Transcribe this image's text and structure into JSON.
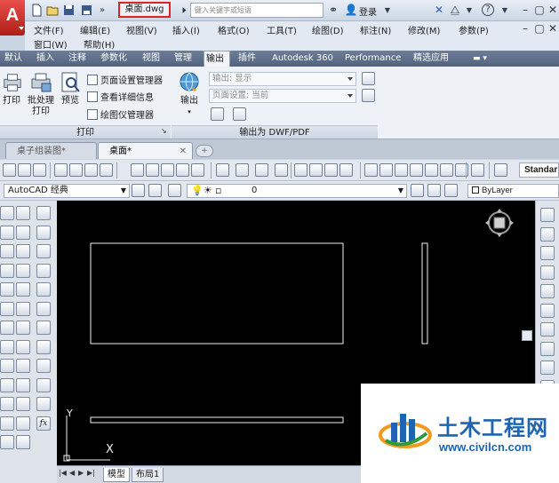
{
  "titlebar": {
    "filename": "桌面.dwg",
    "search_placeholder": "键入关键字或短语",
    "login_label": "登录",
    "help_icon": "?"
  },
  "menubar": {
    "row1": [
      "文件(F)",
      "编辑(E)",
      "视图(V)",
      "插入(I)",
      "格式(O)",
      "工具(T)",
      "绘图(D)",
      "标注(N)",
      "修改(M)",
      "参数(P)"
    ],
    "row2": [
      "窗口(W)",
      "帮助(H)"
    ]
  },
  "ribbon_tabs": [
    "默认",
    "插入",
    "注释",
    "参数化",
    "视图",
    "管理",
    "输出",
    "插件",
    "Autodesk 360",
    "Performance",
    "精选应用"
  ],
  "ribbon": {
    "print_panel": {
      "plot_label": "打印",
      "batch_plot_label": "批处理打印",
      "preview_label": "预览",
      "page_setup_label": "页面设置管理器",
      "details_label": "查看详细信息",
      "plotter_label": "绘图仪管理器",
      "footer": "打印"
    },
    "export_panel": {
      "export_label": "输出",
      "export_combo": "输出: 显示",
      "page_setup_combo": "页面设置: 当前",
      "footer": "输出为 DWF/PDF"
    }
  },
  "doc_tabs": [
    {
      "label": "桌子组装图*",
      "active": false
    },
    {
      "label": "桌面*",
      "active": true
    }
  ],
  "toolbar": {
    "standard_dropdown": "Standar",
    "workspace_dropdown": "AutoCAD 经典",
    "layer_value": "0",
    "color_value": "ByLayer"
  },
  "canvas": {
    "ucs_y_label": "Y",
    "ucs_x_label": "X"
  },
  "model_tabs": [
    "模型",
    "布局1"
  ],
  "watermark": {
    "title": "土木工程网",
    "url": "www.civilcn.com"
  },
  "colors": {
    "canvas_bg": "#000000",
    "ribbon_tab_bg": "#5f7089",
    "highlight_box": "#dd2222",
    "watermark_blue": "#1f64b0"
  }
}
